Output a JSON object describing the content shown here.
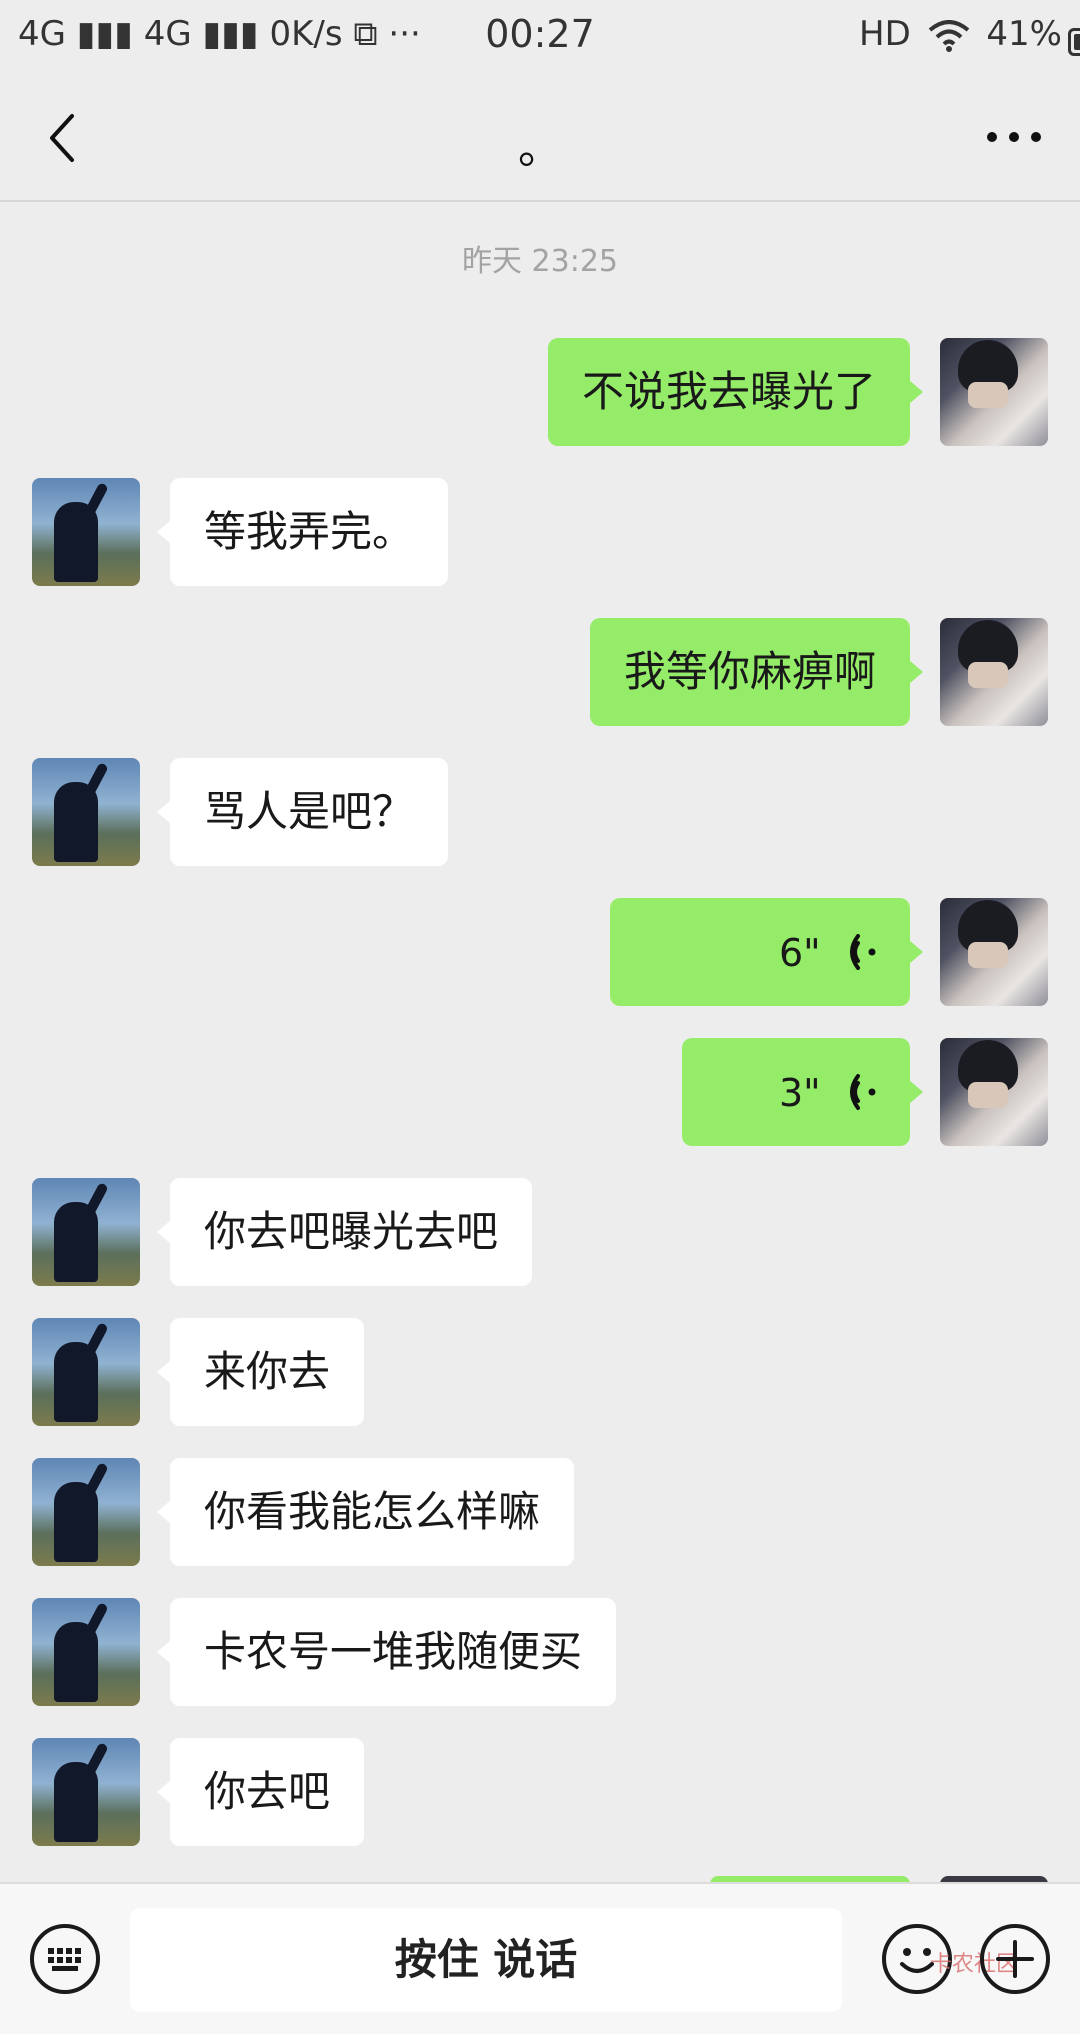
{
  "status_bar": {
    "left": "4G ▮▮▮ 4G ▮▮▮ 0K/s ⧉ ···",
    "time": "00:27",
    "right_hd": "HD",
    "battery_percent": "41%"
  },
  "nav": {
    "title": "。"
  },
  "chat": {
    "timestamp": "昨天 23:25",
    "messages": [
      {
        "side": "right",
        "text": "不说我去曝光了"
      },
      {
        "side": "left",
        "text": "等我弄完。"
      },
      {
        "side": "right",
        "text": "我等你麻痹啊"
      },
      {
        "side": "left",
        "text": "骂人是吧？"
      },
      {
        "side": "right",
        "type": "voice",
        "duration": "6\""
      },
      {
        "side": "right",
        "type": "voice",
        "duration": "3\""
      },
      {
        "side": "left",
        "text": "你去吧曝光去吧"
      },
      {
        "side": "left",
        "text": "来你去"
      },
      {
        "side": "left",
        "text": "你看我能怎么样嘛"
      },
      {
        "side": "left",
        "text": "卡农号一堆我随便买"
      },
      {
        "side": "left",
        "text": "你去吧"
      }
    ]
  },
  "bottom_bar": {
    "talk_label": "按住 说话",
    "watermark": "卡农社区"
  },
  "colors": {
    "background": "#ededed",
    "outgoing_bubble": "#95ec69",
    "incoming_bubble": "#ffffff"
  }
}
